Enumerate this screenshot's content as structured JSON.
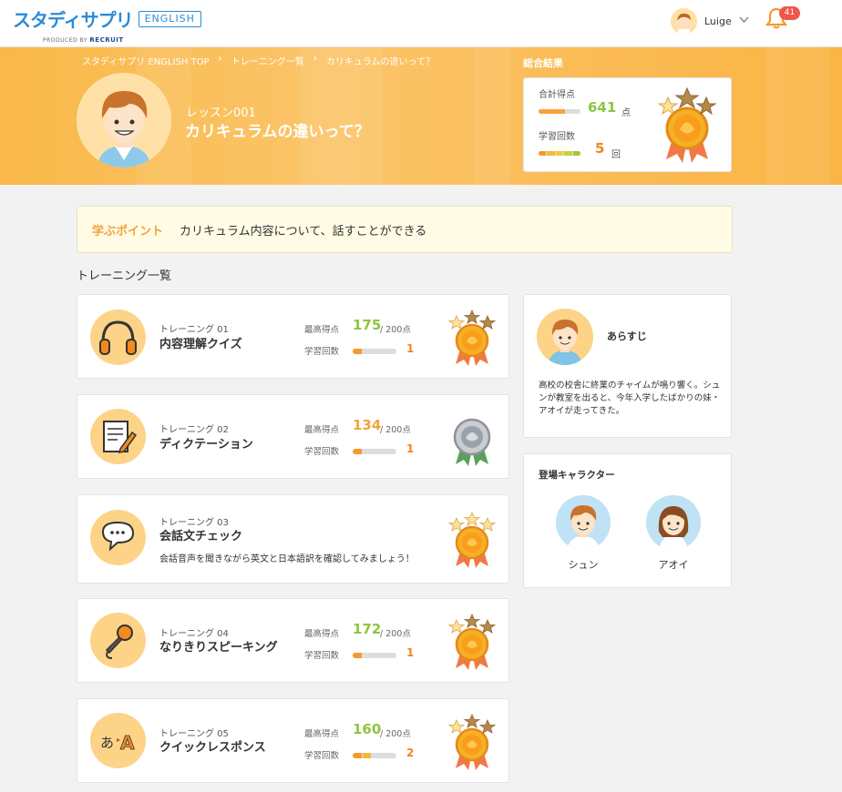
{
  "header": {
    "logo_jp": "スタディサプリ",
    "logo_en": "ENGLISH",
    "logo_sub": "PRODUCED BY",
    "logo_brand": "RECRUIT",
    "user_name": "Luige",
    "notification_count": "41"
  },
  "breadcrumb": [
    "スタディサプリ ENGLISH TOP",
    "トレーニング一覧",
    "カリキュラムの違いって？"
  ],
  "lesson": {
    "number": "レッスン001",
    "title": "カリキュラムの違いって？"
  },
  "summary": {
    "label": "総合結果",
    "total_label": "合計得点",
    "total_score": "641",
    "total_unit": "点",
    "total_fraction": 0.64,
    "count_label": "学習回数",
    "count": "5",
    "count_unit": "回"
  },
  "learning_point": {
    "label": "学ぶポイント",
    "text": "カリキュラム内容について、話すことができる"
  },
  "training_list_title": "トレーニング一覧",
  "trainings": [
    {
      "no": "トレーニング 01",
      "name": "内容理解クイズ",
      "score_label": "最高得点",
      "score": "175",
      "max": "/ 200点",
      "count_label": "学習回数",
      "count": "1",
      "count_fraction": 0.2,
      "score_color": "#8cc63f",
      "medal": "gold",
      "icon": "headphones-icon"
    },
    {
      "no": "トレーニング 02",
      "name": "ディクテーション",
      "score_label": "最高得点",
      "score": "134",
      "max": "/ 200点",
      "count_label": "学習回数",
      "count": "1",
      "count_fraction": 0.2,
      "score_color": "#f3a23a",
      "medal": "silver",
      "icon": "notepad-pencil-icon"
    },
    {
      "no": "トレーニング 03",
      "name": "会話文チェック",
      "description": "会話音声を聞きながら英文と日本語訳を確認してみましょう！",
      "medal": "gold-full",
      "icon": "speech-bubble-icon"
    },
    {
      "no": "トレーニング 04",
      "name": "なりきりスピーキング",
      "score_label": "最高得点",
      "score": "172",
      "max": "/ 200点",
      "count_label": "学習回数",
      "count": "1",
      "count_fraction": 0.2,
      "score_color": "#8cc63f",
      "medal": "gold",
      "icon": "microphone-icon"
    },
    {
      "no": "トレーニング 05",
      "name": "クイックレスポンス",
      "score_label": "最高得点",
      "score": "160",
      "max": "/ 200点",
      "count_label": "学習回数",
      "count": "2",
      "count_fraction": 0.4,
      "score_color": "#8cc63f",
      "medal": "gold",
      "icon": "translate-icon"
    }
  ],
  "synopsis": {
    "title": "あらすじ",
    "text": "高校の校舎に終業のチャイムが鳴り響く。シュンが教室を出ると、今年入学したばかりの妹・アオイが走ってきた。"
  },
  "characters": {
    "title": "登場キャラクター",
    "list": [
      {
        "name": "シュン"
      },
      {
        "name": "アオイ"
      }
    ]
  }
}
